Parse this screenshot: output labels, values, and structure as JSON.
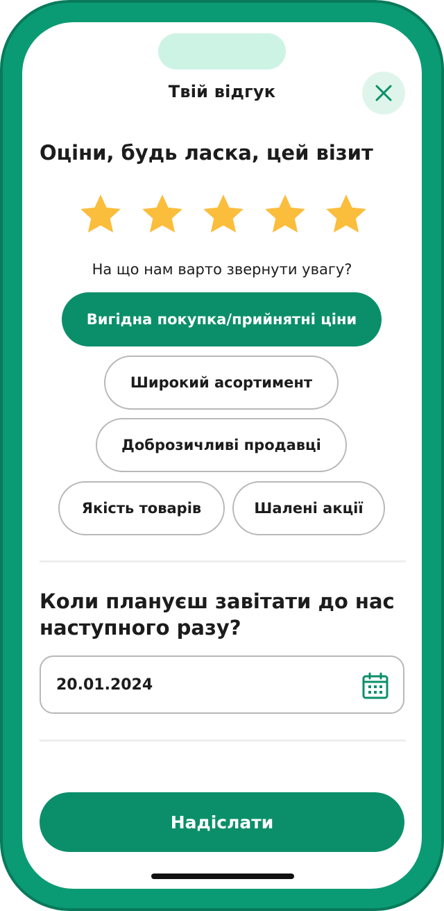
{
  "header": {
    "title": "Твій відгук"
  },
  "rating": {
    "title": "Оціни, будь ласка, цей візит",
    "stars_value": 5,
    "stars_max": 5,
    "star_color": "#fbbd3c"
  },
  "feedback": {
    "question": "На що нам варто звернути увагу?",
    "options": [
      {
        "label": "Вигідна покупка/прийнятні ціни",
        "selected": true
      },
      {
        "label": "Широкий асортимент",
        "selected": false
      },
      {
        "label": "Доброзичливі продавці",
        "selected": false
      },
      {
        "label": "Якість товарів",
        "selected": false
      },
      {
        "label": "Шалені акції",
        "selected": false
      }
    ]
  },
  "next_visit": {
    "title_line1": "Коли плануєш завітати до нас",
    "title_line2": "наступного разу?",
    "date_value": "20.01.2024"
  },
  "submit": {
    "label": "Надіслати"
  },
  "colors": {
    "primary": "#0b8f6a",
    "frame": "#0b9b74",
    "accent_light": "#cdf3e5",
    "star": "#fbbd3c"
  },
  "icons": {
    "close": "close-icon",
    "calendar": "calendar-icon",
    "star": "star-icon"
  }
}
